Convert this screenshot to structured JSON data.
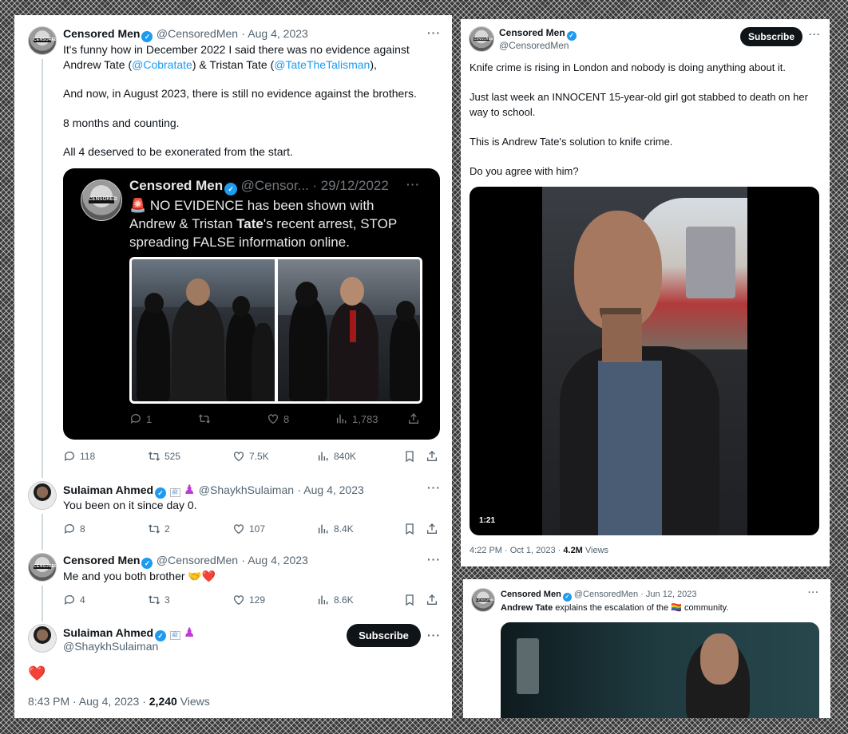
{
  "left": {
    "tweet1": {
      "avatar_text": "CENSORED",
      "name": "Censored Men",
      "handle": "@CensoredMen",
      "date": "· Aug 4, 2023",
      "line1": "It's funny how in December 2022 I said there was no evidence against",
      "line2a": "Andrew Tate (",
      "line2b": "@Cobratate",
      "line2c": ") & Tristan Tate (",
      "line2d": "@TateTheTalisman",
      "line2e": "),",
      "p2": "And now, in August 2023, there is still no evidence against the brothers.",
      "p3": "8 months and counting.",
      "p4": "All 4 deserved to be exonerated from the start.",
      "quote": {
        "name": "Censored Men",
        "handle": "@Censor...",
        "date": "· 29/12/2022",
        "line1": "🚨 NO EVIDENCE has been shown with",
        "line2a": "Andrew & Tristan ",
        "line2b": "Tate",
        "line2c": "'s recent arrest, STOP",
        "line3": "spreading FALSE information online.",
        "replies": "1",
        "likes": "8",
        "views": "1,783"
      },
      "replies": "118",
      "retweets": "525",
      "likes": "7.5K",
      "views": "840K"
    },
    "reply1": {
      "name": "Sulaiman Ahmed",
      "handle": "@ShaykhSulaiman",
      "date": "· Aug 4, 2023",
      "text": "You been on it since day 0.",
      "replies": "8",
      "retweets": "2",
      "likes": "107",
      "views": "8.4K"
    },
    "reply2": {
      "name": "Censored Men",
      "handle": "@CensoredMen",
      "date": "· Aug 4, 2023",
      "text": "Me and you both brother 🤝❤️",
      "replies": "4",
      "retweets": "3",
      "likes": "129",
      "views": "8.6K"
    },
    "reply3": {
      "name": "Sulaiman Ahmed",
      "handle": "@ShaykhSulaiman",
      "subscribe": "Subscribe",
      "text": "❤️",
      "time": "8:43 PM · Aug 4, 2023 · ",
      "views_count": "2,240",
      "views_label": " Views"
    }
  },
  "right_top": {
    "name": "Censored Men",
    "handle": "@CensoredMen",
    "subscribe": "Subscribe",
    "p1": "Knife crime is rising in London and nobody is doing anything about it.",
    "p2a": "Just last week an INNOCENT 15-year-old girl got stabbed to death on her",
    "p2b": "way to school.",
    "p3": "This is Andrew Tate's solution to knife crime.",
    "p4": "Do you agree with him?",
    "video_duration": "1:21",
    "time": "4:22 PM · Oct 1, 2023 · ",
    "views_count": "4.2M",
    "views_label": " Views"
  },
  "right_bottom": {
    "name": "Censored Men",
    "handle": "@CensoredMen",
    "date": "· Jun 12, 2023",
    "text_bold": "Andrew Tate",
    "text_rest": " explains the escalation of the 🏳️‍🌈 community."
  },
  "colors": {
    "accent": "#1d9bf0",
    "text": "#0f1419",
    "muted": "#536471",
    "quote_bg": "#000000"
  }
}
